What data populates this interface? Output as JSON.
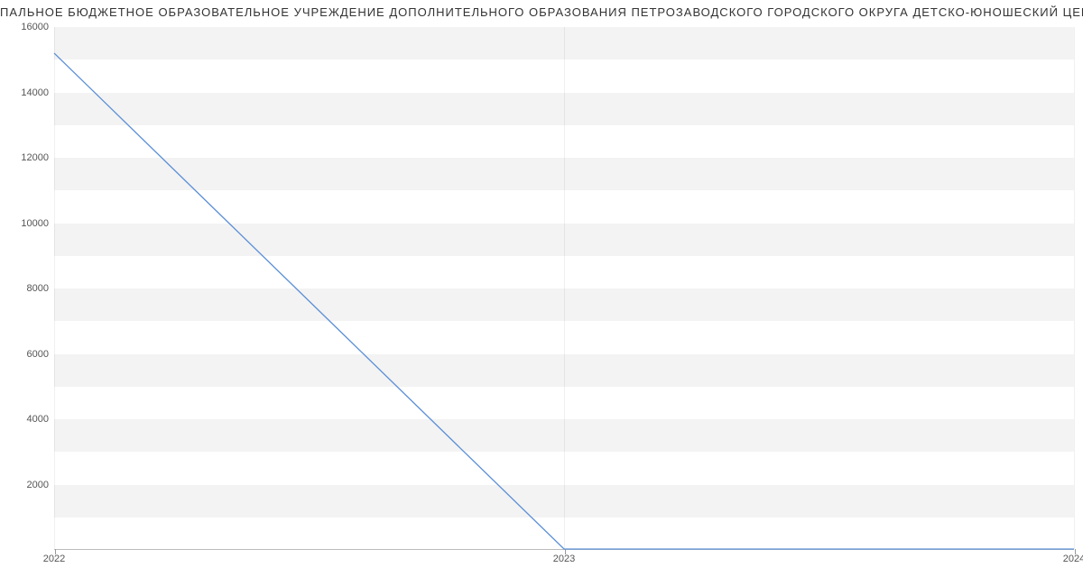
{
  "title": "ПАЛЬНОЕ БЮДЖЕТНОЕ ОБРАЗОВАТЕЛЬНОЕ УЧРЕЖДЕНИЕ ДОПОЛНИТЕЛЬНОГО ОБРАЗОВАНИЯ ПЕТРОЗАВОДСКОГО ГОРОДСКОГО ОКРУГА ДЕТСКО-ЮНОШЕСКИЙ ЦЕНТР ",
  "chart_data": {
    "type": "line",
    "x": [
      2022,
      2023,
      2024
    ],
    "values": [
      15200,
      0,
      0
    ],
    "x_ticks": [
      2022,
      2023,
      2024
    ],
    "y_ticks": [
      2000,
      4000,
      6000,
      8000,
      10000,
      12000,
      14000,
      16000
    ],
    "xlim": [
      2022,
      2024
    ],
    "ylim": [
      0,
      16000
    ],
    "bands": [
      [
        1000,
        2000
      ],
      [
        3000,
        4000
      ],
      [
        5000,
        6000
      ],
      [
        7000,
        8000
      ],
      [
        9000,
        10000
      ],
      [
        11000,
        12000
      ],
      [
        13000,
        14000
      ],
      [
        15000,
        16000
      ]
    ],
    "title": "",
    "xlabel": "",
    "ylabel": ""
  }
}
